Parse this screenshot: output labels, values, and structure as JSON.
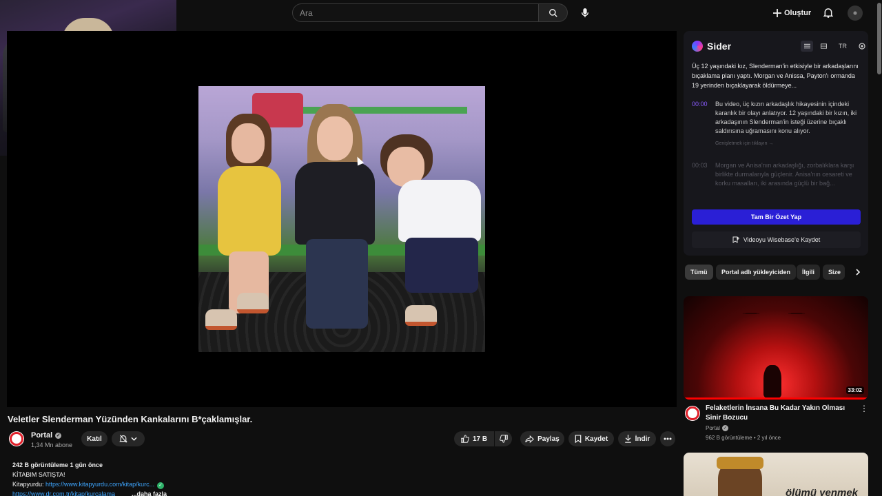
{
  "header": {
    "search_placeholder": "Ara",
    "create_label": "Oluştur"
  },
  "video": {
    "title": "Veletler Slenderman Yüzünden Kankalarını B*çaklamışlar.",
    "channel_name": "Portal",
    "subscribers": "1,34 Mn abone",
    "join_label": "Katıl",
    "like_count": "17 B",
    "share_label": "Paylaş",
    "save_label": "Kaydet",
    "download_label": "İndir"
  },
  "description": {
    "stats": "242 B görüntüleme  1 gün önce",
    "line1": "KİTABIM SATIŞTA!",
    "line2_prefix": "Kitapyurdu: ",
    "line2_link": "https://www.kitapyurdu.com/kitap/kurc...",
    "line3_link": "https://www.dr.com.tr/kitap/kurcalama",
    "more_label": "...daha fazla"
  },
  "sider": {
    "brand": "Sider",
    "lang": "TR",
    "summary": "Üç 12 yaşındaki kız, Slenderman'in etkisiyle bir arkadaşlarını bıçaklama planı yaptı. Morgan ve Anissa, Payton'ı ormanda 19 yerinden bıçaklayarak öldürmeye...",
    "items": [
      {
        "time": "00:00",
        "text": "Bu video, üç kızın arkadaşlık hikayesinin içindeki karanlık bir olayı anlatıyor. 12 yaşındaki bir kızın, iki arkadaşının Slenderman'in isteği üzerine bıçaklı saldırısına uğramasını konu alıyor."
      },
      {
        "time": "00:03",
        "text": "Morgan ve Anisa'nın arkadaşlığı, zorbalıklara karşı birlikte durmalarıyla güçlenir. Anisa'nın cesareti ve korku masalları, iki arasında güçlü bir bağ..."
      }
    ],
    "expand_hint": "Genişletmek için tıklayın →",
    "cta_label": "Tam Bir Özet Yap",
    "save_label": "Videoyu Wisebase'e Kaydet"
  },
  "chips": [
    "Tümü",
    "Portal adlı yükleyiciden",
    "İlgili",
    "Size"
  ],
  "recommendations": [
    {
      "title": "Felaketlerin İnsana Bu Kadar Yakın Olması Sinir Bozucu",
      "channel": "Portal",
      "meta": "962 B görüntüleme • 2 yıl önce",
      "duration": "33:02",
      "progress": 1.0
    },
    {
      "caption": "ölümü yenmek"
    }
  ],
  "colors": {
    "accent": "#2a1fd6",
    "link": "#3ea6ff",
    "sider_timestamp": "#8a5bff",
    "youtube_red": "#ff0000"
  }
}
